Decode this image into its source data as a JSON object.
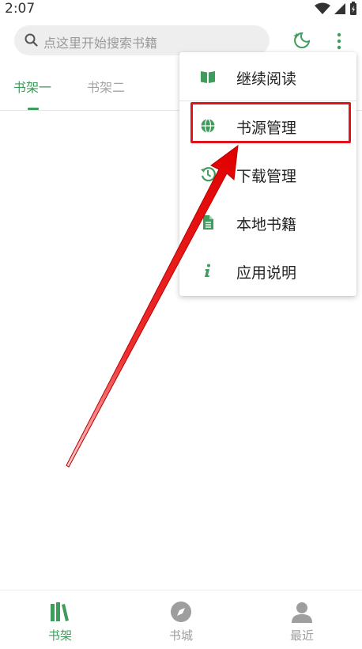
{
  "status_bar": {
    "time": "2:07"
  },
  "search": {
    "placeholder": "点这里开始搜索书籍"
  },
  "tabs": [
    {
      "label": "书架一"
    },
    {
      "label": "书架二"
    }
  ],
  "menu": {
    "items": [
      {
        "label": "继续阅读",
        "icon": "book-open-icon"
      },
      {
        "label": "书源管理",
        "icon": "globe-icon"
      },
      {
        "label": "下载管理",
        "icon": "history-icon"
      },
      {
        "label": "本地书籍",
        "icon": "document-icon"
      },
      {
        "label": "应用说明",
        "icon": "info-icon"
      }
    ],
    "highlighted_item": "书源管理"
  },
  "bottom_nav": [
    {
      "label": "书架",
      "icon": "bookshelf-icon",
      "active": true
    },
    {
      "label": "书城",
      "icon": "compass-icon",
      "active": false
    },
    {
      "label": "最近",
      "icon": "person-icon",
      "active": false
    }
  ],
  "colors": {
    "accent": "#3f9c5c",
    "annotation": "#e0121a"
  }
}
